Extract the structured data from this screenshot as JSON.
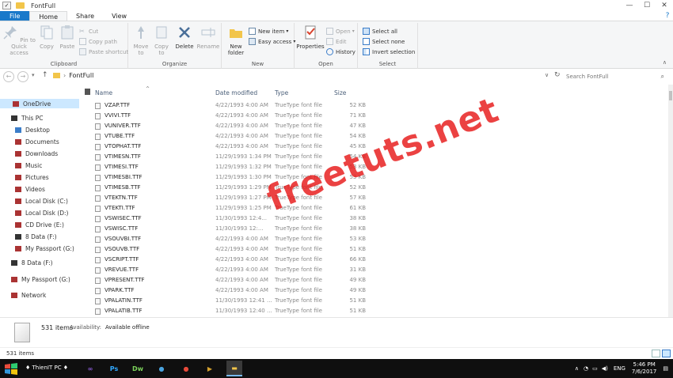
{
  "window": {
    "title": "FontFull"
  },
  "tabs": [
    {
      "label": "File",
      "kind": "file"
    },
    {
      "label": "Home",
      "kind": "active"
    },
    {
      "label": "Share",
      "kind": "normal"
    },
    {
      "label": "View",
      "kind": "normal"
    }
  ],
  "ribbon": {
    "clipboard": {
      "label": "Clipboard",
      "pin": "Pin to Quick access",
      "copy": "Copy",
      "paste": "Paste",
      "cut": "Cut",
      "copy_path": "Copy path",
      "paste_shortcut": "Paste shortcut"
    },
    "organize": {
      "label": "Organize",
      "move_to": "Move to",
      "copy_to": "Copy to",
      "delete": "Delete",
      "rename": "Rename"
    },
    "new": {
      "label": "New",
      "new_folder": "New folder",
      "new_item": "New item",
      "easy_access": "Easy access"
    },
    "open": {
      "label": "Open",
      "properties": "Properties",
      "open": "Open",
      "edit": "Edit",
      "history": "History"
    },
    "select": {
      "label": "Select",
      "select_all": "Select all",
      "select_none": "Select none",
      "invert": "Invert selection"
    }
  },
  "address": {
    "path": "FontFull",
    "search_placeholder": "Search FontFull"
  },
  "nav": [
    {
      "label": "OneDrive",
      "selected": true,
      "level": 0,
      "color": "#a33"
    },
    {
      "label": "This PC",
      "selected": false,
      "level": 0,
      "color": "#333"
    },
    {
      "label": "Desktop",
      "selected": false,
      "level": 1,
      "color": "#3b7dc9"
    },
    {
      "label": "Documents",
      "selected": false,
      "level": 1,
      "color": "#a33"
    },
    {
      "label": "Downloads",
      "selected": false,
      "level": 1,
      "color": "#a33"
    },
    {
      "label": "Music",
      "selected": false,
      "level": 1,
      "color": "#a33"
    },
    {
      "label": "Pictures",
      "selected": false,
      "level": 1,
      "color": "#a33"
    },
    {
      "label": "Videos",
      "selected": false,
      "level": 1,
      "color": "#a33"
    },
    {
      "label": "Local Disk (C:)",
      "selected": false,
      "level": 1,
      "color": "#a33"
    },
    {
      "label": "Local Disk (D:)",
      "selected": false,
      "level": 1,
      "color": "#a33"
    },
    {
      "label": "CD Drive (E:)",
      "selected": false,
      "level": 1,
      "color": "#a33"
    },
    {
      "label": "8 Data (F:)",
      "selected": false,
      "level": 1,
      "color": "#333"
    },
    {
      "label": "My Passport (G:)",
      "selected": false,
      "level": 1,
      "color": "#a33"
    },
    {
      "label": "8 Data (F:)",
      "selected": false,
      "level": 0,
      "color": "#333"
    },
    {
      "label": "My Passport (G:)",
      "selected": false,
      "level": 0,
      "color": "#a33"
    },
    {
      "label": "Network",
      "selected": false,
      "level": 0,
      "color": "#a33"
    }
  ],
  "columns": {
    "name": "Name",
    "date": "Date modified",
    "type": "Type",
    "size": "Size"
  },
  "files": [
    {
      "name": "VZAP.TTF",
      "date": "4/22/1993 4:00 AM",
      "type": "TrueType font file",
      "size": "52 KB"
    },
    {
      "name": "VVIVI.TTF",
      "date": "4/22/1993 4:00 AM",
      "type": "TrueType font file",
      "size": "71 KB"
    },
    {
      "name": "VUNIVER.TTF",
      "date": "4/22/1993 4:00 AM",
      "type": "TrueType font file",
      "size": "47 KB"
    },
    {
      "name": "VTUBE.TTF",
      "date": "4/22/1993 4:00 AM",
      "type": "TrueType font file",
      "size": "54 KB"
    },
    {
      "name": "VTOPHAT.TTF",
      "date": "4/22/1993 4:00 AM",
      "type": "TrueType font file",
      "size": "45 KB"
    },
    {
      "name": "VTIMESN.TTF",
      "date": "11/29/1993 1:34 PM",
      "type": "TrueType font file",
      "size": "54 KB"
    },
    {
      "name": "VTIMESI.TTF",
      "date": "11/29/1993 1:32 PM",
      "type": "TrueType font file",
      "size": "53 KB"
    },
    {
      "name": "VTIMESBI.TTF",
      "date": "11/29/1993 1:30 PM",
      "type": "TrueType font file",
      "size": "53 KB"
    },
    {
      "name": "VTIMESB.TTF",
      "date": "11/29/1993 1:29 PM",
      "type": "TrueType font file",
      "size": "52 KB"
    },
    {
      "name": "VTEKTN.TTF",
      "date": "11/29/1993 1:27 PM",
      "type": "TrueType font file",
      "size": "57 KB"
    },
    {
      "name": "VTEKTI.TTF",
      "date": "11/29/1993 1:25 PM",
      "type": "TrueType font file",
      "size": "61 KB"
    },
    {
      "name": "VSWISEC.TTF",
      "date": "11/30/1993 12:4...",
      "type": "TrueType font file",
      "size": "38 KB"
    },
    {
      "name": "VSWISC.TTF",
      "date": "11/30/1993 12:...",
      "type": "TrueType font file",
      "size": "38 KB"
    },
    {
      "name": "VSOUVBI.TTF",
      "date": "4/22/1993 4:00 AM",
      "type": "TrueType font file",
      "size": "53 KB"
    },
    {
      "name": "VSOUVB.TTF",
      "date": "4/22/1993 4:00 AM",
      "type": "TrueType font file",
      "size": "51 KB"
    },
    {
      "name": "VSCRIPT.TTF",
      "date": "4/22/1993 4:00 AM",
      "type": "TrueType font file",
      "size": "66 KB"
    },
    {
      "name": "VREVUE.TTF",
      "date": "4/22/1993 4:00 AM",
      "type": "TrueType font file",
      "size": "31 KB"
    },
    {
      "name": "VPRESENT.TTF",
      "date": "4/22/1993 4:00 AM",
      "type": "TrueType font file",
      "size": "49 KB"
    },
    {
      "name": "VPARK.TTF",
      "date": "4/22/1993 4:00 AM",
      "type": "TrueType font file",
      "size": "49 KB"
    },
    {
      "name": "VPALATIN.TTF",
      "date": "11/30/1993 12:41 ...",
      "type": "TrueType font file",
      "size": "51 KB"
    },
    {
      "name": "VPALATIB.TTF",
      "date": "11/30/1993 12:40 ...",
      "type": "TrueType font file",
      "size": "51 KB"
    }
  ],
  "watermark": "freetuts.net",
  "details": {
    "count": "531 items",
    "availability_label": "Availability:",
    "availability_value": "Available offline"
  },
  "status": {
    "items": "531 items"
  },
  "taskbar": {
    "pc_name": "♦ ThienIT PC ♦",
    "apps": [
      {
        "name": "visual-studio",
        "glyph": "∞",
        "color": "#8a5cd6",
        "active": false
      },
      {
        "name": "photoshop",
        "glyph": "Ps",
        "color": "#31a8ff",
        "active": false
      },
      {
        "name": "dreamweaver",
        "glyph": "Dw",
        "color": "#7cd35b",
        "active": false
      },
      {
        "name": "chrome-blue",
        "glyph": "●",
        "color": "#4aa3df",
        "active": false
      },
      {
        "name": "chrome",
        "glyph": "●",
        "color": "#e84a3a",
        "active": false
      },
      {
        "name": "media-player",
        "glyph": "▶",
        "color": "#d4a12e",
        "active": false
      },
      {
        "name": "file-explorer",
        "glyph": "▬",
        "color": "#f2c54a",
        "active": true
      }
    ],
    "lang": "ENG",
    "time": "5:46 PM",
    "date": "7/6/2017"
  }
}
